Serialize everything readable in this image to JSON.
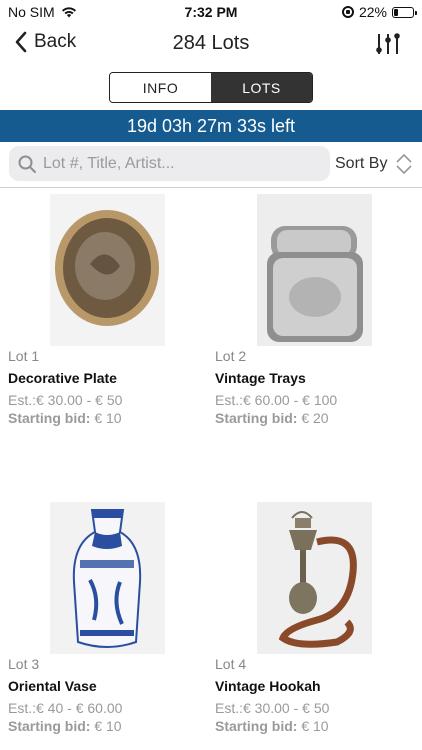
{
  "status_bar": {
    "carrier": "No SIM",
    "time": "7:32 PM",
    "battery": "22%",
    "battery_level": 0.22
  },
  "nav": {
    "back_label": "Back",
    "title": "284 Lots"
  },
  "segments": {
    "info": "INFO",
    "lots": "LOTS",
    "selected": "LOTS"
  },
  "banner": {
    "countdown": "19d 03h 27m 33s left"
  },
  "search": {
    "placeholder": "Lot #, Title, Artist...",
    "value": ""
  },
  "sort": {
    "label": "Sort By"
  },
  "lots": [
    {
      "lot": "Lot 1",
      "title": "Decorative Plate",
      "est": "Est.:€ 30.00 - € 50",
      "bid_label": "Starting bid:",
      "bid_value": "€ 10",
      "image_icon": "decorative-plate"
    },
    {
      "lot": "Lot 2",
      "title": "Vintage Trays",
      "est": "Est.:€ 60.00 - € 100",
      "bid_label": "Starting bid:",
      "bid_value": "€ 20",
      "image_icon": "silver-trays"
    },
    {
      "lot": "Lot 3",
      "title": "Oriental Vase",
      "est": "Est.:€ 40 - € 60.00",
      "bid_label": "Starting bid:",
      "bid_value": "€ 10",
      "image_icon": "blue-white-vase"
    },
    {
      "lot": "Lot 4",
      "title": "Vintage Hookah",
      "est": "Est.:€ 30.00 - € 50",
      "bid_label": "Starting bid:",
      "bid_value": "€ 10",
      "image_icon": "hookah"
    }
  ],
  "colors": {
    "banner": "#155b8f",
    "segment_selected": "#333333"
  }
}
